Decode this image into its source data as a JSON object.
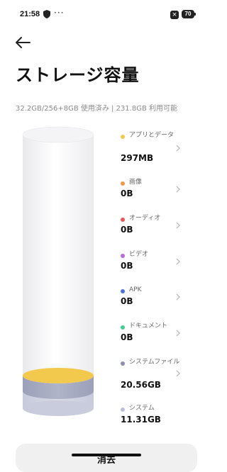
{
  "status_bar": {
    "time": "21:58",
    "dots": "···",
    "close_badge": "×",
    "battery": "70"
  },
  "header": {
    "title": "ストレージ容量"
  },
  "usage": "32.2GB/256+8GB 使用済み | 231.8GB 利用可能",
  "categories": [
    {
      "label": "アプリとデータ",
      "value": "297MB",
      "color": "#f2c94c"
    },
    {
      "label": "画像",
      "value": "0B",
      "color": "#f2994a"
    },
    {
      "label": "オーディオ",
      "value": "0B",
      "color": "#eb5757"
    },
    {
      "label": "ビデオ",
      "value": "0B",
      "color": "#bb6bd9"
    },
    {
      "label": "APK",
      "value": "0B",
      "color": "#4a74d4"
    },
    {
      "label": "ドキュメント",
      "value": "0B",
      "color": "#3fcf8e"
    },
    {
      "label": "システムファイル",
      "value": "20.56GB",
      "color": "#8a90ad"
    },
    {
      "label": "システム",
      "value": "11.31GB",
      "color": "#b9bfd6"
    }
  ],
  "actions": {
    "clear_label": "消去"
  }
}
